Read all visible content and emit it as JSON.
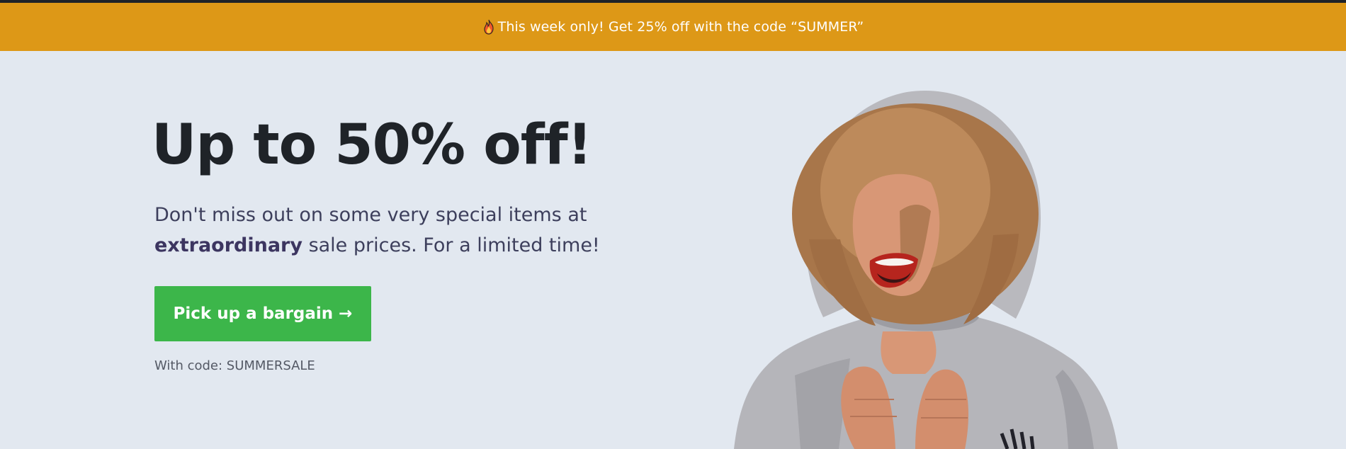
{
  "announcement": {
    "icon": "fire-icon",
    "text": "This week only! Get 25% off with the code “SUMMER”",
    "background": "#dd9817"
  },
  "hero": {
    "headline": "Up to 50% off!",
    "subtext_prefix": "Don't miss out on some very special items at ",
    "subtext_emphasis": "extraordinary",
    "subtext_suffix": " sale prices. For a limited time!",
    "cta_label": "Pick up a bargain →",
    "cta_color": "#3cb64a",
    "code_note": "With code: SUMMERSALE",
    "background": "#e2e8f0"
  }
}
